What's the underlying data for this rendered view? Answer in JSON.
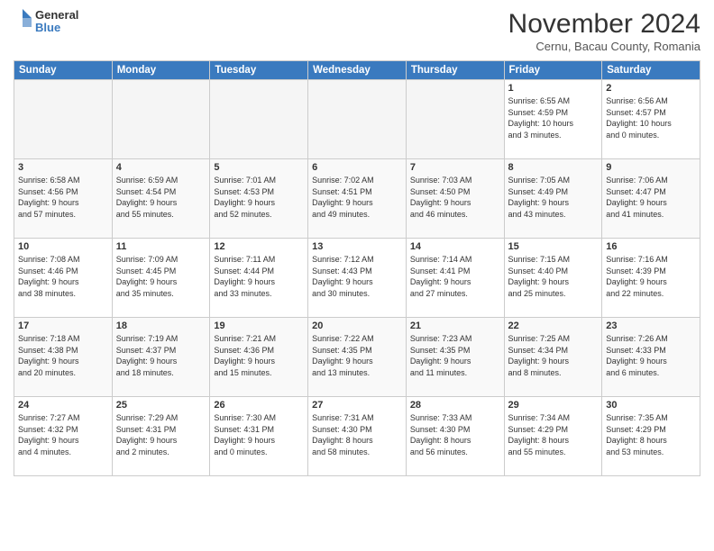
{
  "header": {
    "logo_general": "General",
    "logo_blue": "Blue",
    "month_title": "November 2024",
    "subtitle": "Cernu, Bacau County, Romania"
  },
  "weekdays": [
    "Sunday",
    "Monday",
    "Tuesday",
    "Wednesday",
    "Thursday",
    "Friday",
    "Saturday"
  ],
  "weeks": [
    [
      {
        "day": "",
        "info": ""
      },
      {
        "day": "",
        "info": ""
      },
      {
        "day": "",
        "info": ""
      },
      {
        "day": "",
        "info": ""
      },
      {
        "day": "",
        "info": ""
      },
      {
        "day": "1",
        "info": "Sunrise: 6:55 AM\nSunset: 4:59 PM\nDaylight: 10 hours\nand 3 minutes."
      },
      {
        "day": "2",
        "info": "Sunrise: 6:56 AM\nSunset: 4:57 PM\nDaylight: 10 hours\nand 0 minutes."
      }
    ],
    [
      {
        "day": "3",
        "info": "Sunrise: 6:58 AM\nSunset: 4:56 PM\nDaylight: 9 hours\nand 57 minutes."
      },
      {
        "day": "4",
        "info": "Sunrise: 6:59 AM\nSunset: 4:54 PM\nDaylight: 9 hours\nand 55 minutes."
      },
      {
        "day": "5",
        "info": "Sunrise: 7:01 AM\nSunset: 4:53 PM\nDaylight: 9 hours\nand 52 minutes."
      },
      {
        "day": "6",
        "info": "Sunrise: 7:02 AM\nSunset: 4:51 PM\nDaylight: 9 hours\nand 49 minutes."
      },
      {
        "day": "7",
        "info": "Sunrise: 7:03 AM\nSunset: 4:50 PM\nDaylight: 9 hours\nand 46 minutes."
      },
      {
        "day": "8",
        "info": "Sunrise: 7:05 AM\nSunset: 4:49 PM\nDaylight: 9 hours\nand 43 minutes."
      },
      {
        "day": "9",
        "info": "Sunrise: 7:06 AM\nSunset: 4:47 PM\nDaylight: 9 hours\nand 41 minutes."
      }
    ],
    [
      {
        "day": "10",
        "info": "Sunrise: 7:08 AM\nSunset: 4:46 PM\nDaylight: 9 hours\nand 38 minutes."
      },
      {
        "day": "11",
        "info": "Sunrise: 7:09 AM\nSunset: 4:45 PM\nDaylight: 9 hours\nand 35 minutes."
      },
      {
        "day": "12",
        "info": "Sunrise: 7:11 AM\nSunset: 4:44 PM\nDaylight: 9 hours\nand 33 minutes."
      },
      {
        "day": "13",
        "info": "Sunrise: 7:12 AM\nSunset: 4:43 PM\nDaylight: 9 hours\nand 30 minutes."
      },
      {
        "day": "14",
        "info": "Sunrise: 7:14 AM\nSunset: 4:41 PM\nDaylight: 9 hours\nand 27 minutes."
      },
      {
        "day": "15",
        "info": "Sunrise: 7:15 AM\nSunset: 4:40 PM\nDaylight: 9 hours\nand 25 minutes."
      },
      {
        "day": "16",
        "info": "Sunrise: 7:16 AM\nSunset: 4:39 PM\nDaylight: 9 hours\nand 22 minutes."
      }
    ],
    [
      {
        "day": "17",
        "info": "Sunrise: 7:18 AM\nSunset: 4:38 PM\nDaylight: 9 hours\nand 20 minutes."
      },
      {
        "day": "18",
        "info": "Sunrise: 7:19 AM\nSunset: 4:37 PM\nDaylight: 9 hours\nand 18 minutes."
      },
      {
        "day": "19",
        "info": "Sunrise: 7:21 AM\nSunset: 4:36 PM\nDaylight: 9 hours\nand 15 minutes."
      },
      {
        "day": "20",
        "info": "Sunrise: 7:22 AM\nSunset: 4:35 PM\nDaylight: 9 hours\nand 13 minutes."
      },
      {
        "day": "21",
        "info": "Sunrise: 7:23 AM\nSunset: 4:35 PM\nDaylight: 9 hours\nand 11 minutes."
      },
      {
        "day": "22",
        "info": "Sunrise: 7:25 AM\nSunset: 4:34 PM\nDaylight: 9 hours\nand 8 minutes."
      },
      {
        "day": "23",
        "info": "Sunrise: 7:26 AM\nSunset: 4:33 PM\nDaylight: 9 hours\nand 6 minutes."
      }
    ],
    [
      {
        "day": "24",
        "info": "Sunrise: 7:27 AM\nSunset: 4:32 PM\nDaylight: 9 hours\nand 4 minutes."
      },
      {
        "day": "25",
        "info": "Sunrise: 7:29 AM\nSunset: 4:31 PM\nDaylight: 9 hours\nand 2 minutes."
      },
      {
        "day": "26",
        "info": "Sunrise: 7:30 AM\nSunset: 4:31 PM\nDaylight: 9 hours\nand 0 minutes."
      },
      {
        "day": "27",
        "info": "Sunrise: 7:31 AM\nSunset: 4:30 PM\nDaylight: 8 hours\nand 58 minutes."
      },
      {
        "day": "28",
        "info": "Sunrise: 7:33 AM\nSunset: 4:30 PM\nDaylight: 8 hours\nand 56 minutes."
      },
      {
        "day": "29",
        "info": "Sunrise: 7:34 AM\nSunset: 4:29 PM\nDaylight: 8 hours\nand 55 minutes."
      },
      {
        "day": "30",
        "info": "Sunrise: 7:35 AM\nSunset: 4:29 PM\nDaylight: 8 hours\nand 53 minutes."
      }
    ]
  ]
}
